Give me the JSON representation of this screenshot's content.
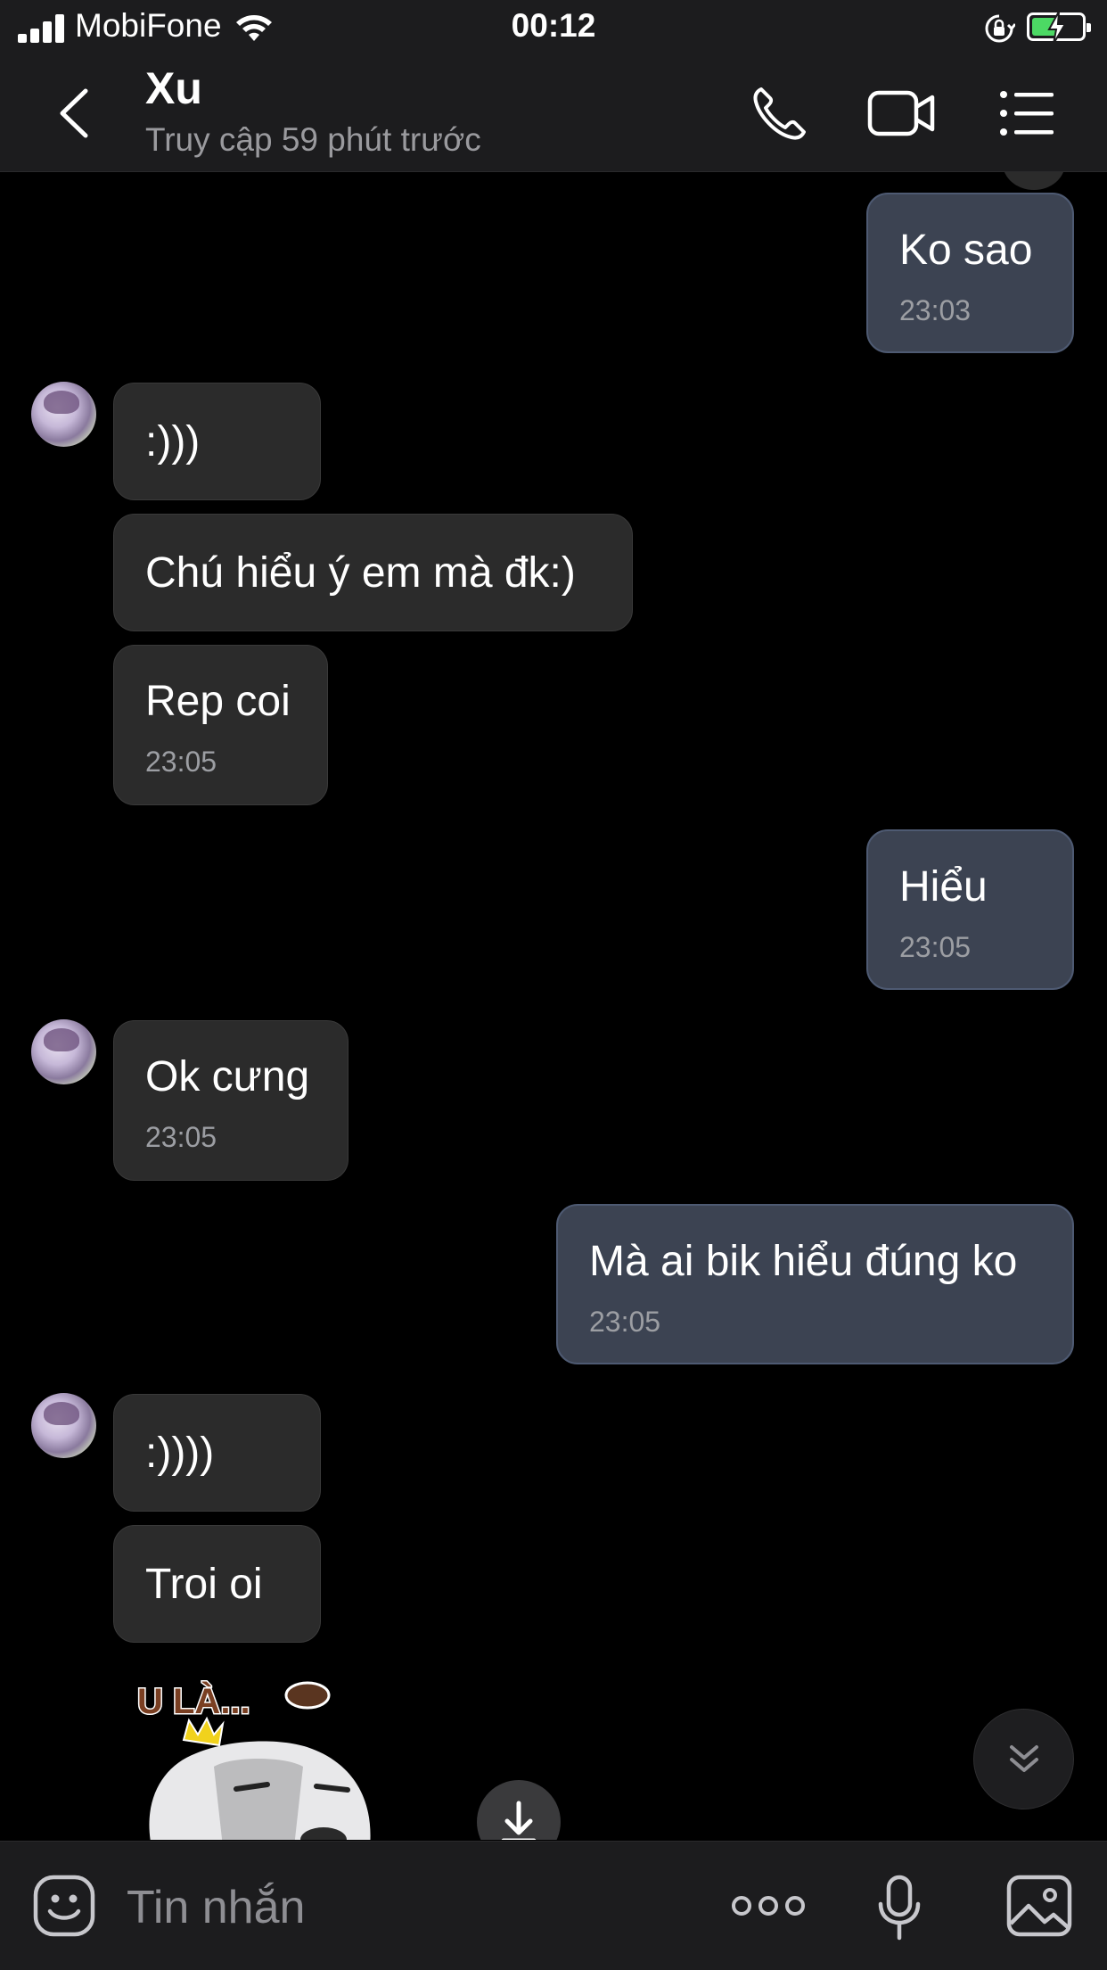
{
  "status_bar": {
    "carrier": "MobiFone",
    "time": "00:12"
  },
  "header": {
    "name": "Xu",
    "status": "Truy cập 59 phút trước"
  },
  "messages": [
    {
      "side": "out",
      "text": "Ko sao",
      "time": "23:03"
    },
    {
      "side": "in",
      "text": ":)))"
    },
    {
      "side": "in",
      "text": "Chú hiểu ý em mà đk:)"
    },
    {
      "side": "in",
      "text": "Rep coi",
      "time": "23:05"
    },
    {
      "side": "out",
      "text": "Hiểu",
      "time": "23:05"
    },
    {
      "side": "in",
      "text": "Ok cưng",
      "time": "23:05"
    },
    {
      "side": "out",
      "text": "Mà ai bik hiểu đúng ko",
      "time": "23:05"
    },
    {
      "side": "in",
      "text": ":))))"
    },
    {
      "side": "in",
      "text": "Troi oi"
    }
  ],
  "sticker": {
    "caption": "U LÀ..."
  },
  "input": {
    "placeholder": "Tin nhắn"
  },
  "colors": {
    "incoming_bubble": "#2b2b2b",
    "outgoing_bubble": "#3c4352",
    "background": "#000000"
  },
  "icons": [
    "signal-icon",
    "wifi-icon",
    "rotation-lock-icon",
    "battery-icon",
    "back-chevron-icon",
    "phone-icon",
    "video-camera-icon",
    "list-menu-icon",
    "download-icon",
    "double-chevron-down-icon",
    "emoji-icon",
    "more-dots-icon",
    "microphone-icon",
    "image-icon"
  ]
}
